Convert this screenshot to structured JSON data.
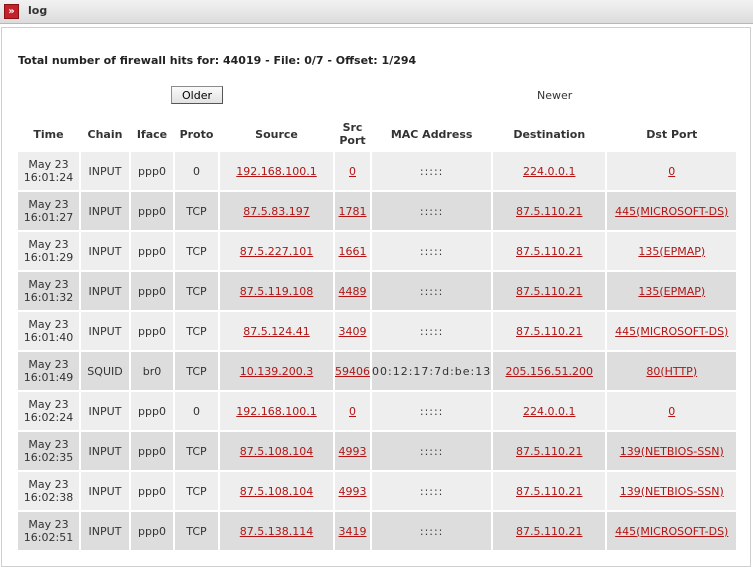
{
  "window": {
    "title": "log",
    "icon": "double-chevron-right-icon"
  },
  "summary": "Total number of firewall hits for: 44019 - File: 0/7 - Offset: 1/294",
  "nav": {
    "older_label": "Older",
    "newer_label": "Newer"
  },
  "columns": [
    "Time",
    "Chain",
    "Iface",
    "Proto",
    "Source",
    "Src Port",
    "MAC Address",
    "Destination",
    "Dst Port"
  ],
  "rows": [
    {
      "date": "May 23",
      "time": "16:01:24",
      "chain": "INPUT",
      "iface": "ppp0",
      "proto": "0",
      "source": "192.168.100.1",
      "src_port": "0",
      "mac": ":::::",
      "destination": "224.0.0.1",
      "dst_port": "0"
    },
    {
      "date": "May 23",
      "time": "16:01:27",
      "chain": "INPUT",
      "iface": "ppp0",
      "proto": "TCP",
      "source": "87.5.83.197",
      "src_port": "1781",
      "mac": ":::::",
      "destination": "87.5.110.21",
      "dst_port": "445(MICROSOFT-DS)"
    },
    {
      "date": "May 23",
      "time": "16:01:29",
      "chain": "INPUT",
      "iface": "ppp0",
      "proto": "TCP",
      "source": "87.5.227.101",
      "src_port": "1661",
      "mac": ":::::",
      "destination": "87.5.110.21",
      "dst_port": "135(EPMAP)"
    },
    {
      "date": "May 23",
      "time": "16:01:32",
      "chain": "INPUT",
      "iface": "ppp0",
      "proto": "TCP",
      "source": "87.5.119.108",
      "src_port": "4489",
      "mac": ":::::",
      "destination": "87.5.110.21",
      "dst_port": "135(EPMAP)"
    },
    {
      "date": "May 23",
      "time": "16:01:40",
      "chain": "INPUT",
      "iface": "ppp0",
      "proto": "TCP",
      "source": "87.5.124.41",
      "src_port": "3409",
      "mac": ":::::",
      "destination": "87.5.110.21",
      "dst_port": "445(MICROSOFT-DS)"
    },
    {
      "date": "May 23",
      "time": "16:01:49",
      "chain": "SQUID",
      "iface": "br0",
      "proto": "TCP",
      "source": "10.139.200.3",
      "src_port": "59406",
      "mac": "00:12:17:7d:be:13",
      "destination": "205.156.51.200",
      "dst_port": "80(HTTP)"
    },
    {
      "date": "May 23",
      "time": "16:02:24",
      "chain": "INPUT",
      "iface": "ppp0",
      "proto": "0",
      "source": "192.168.100.1",
      "src_port": "0",
      "mac": ":::::",
      "destination": "224.0.0.1",
      "dst_port": "0"
    },
    {
      "date": "May 23",
      "time": "16:02:35",
      "chain": "INPUT",
      "iface": "ppp0",
      "proto": "TCP",
      "source": "87.5.108.104",
      "src_port": "4993",
      "mac": ":::::",
      "destination": "87.5.110.21",
      "dst_port": "139(NETBIOS-SSN)"
    },
    {
      "date": "May 23",
      "time": "16:02:38",
      "chain": "INPUT",
      "iface": "ppp0",
      "proto": "TCP",
      "source": "87.5.108.104",
      "src_port": "4993",
      "mac": ":::::",
      "destination": "87.5.110.21",
      "dst_port": "139(NETBIOS-SSN)"
    },
    {
      "date": "May 23",
      "time": "16:02:51",
      "chain": "INPUT",
      "iface": "ppp0",
      "proto": "TCP",
      "source": "87.5.138.114",
      "src_port": "3419",
      "mac": ":::::",
      "destination": "87.5.110.21",
      "dst_port": "445(MICROSOFT-DS)"
    }
  ]
}
